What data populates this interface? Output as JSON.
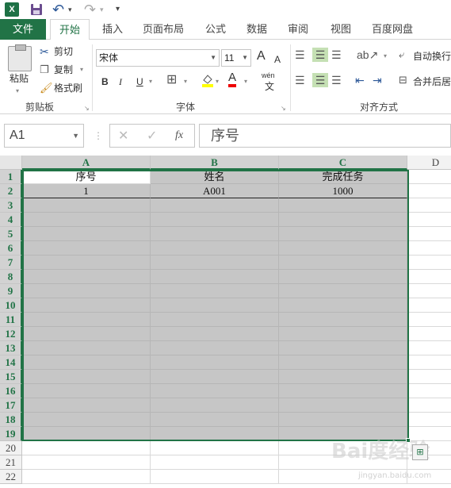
{
  "quick_access": {
    "app_icon": "X",
    "save_icon": "floppy-disk",
    "undo_icon": "↶",
    "redo_icon": "↷",
    "more_icon": "▾"
  },
  "tabs": [
    {
      "label": "文件"
    },
    {
      "label": "开始"
    },
    {
      "label": "插入"
    },
    {
      "label": "页面布局"
    },
    {
      "label": "公式"
    },
    {
      "label": "数据"
    },
    {
      "label": "审阅"
    },
    {
      "label": "视图"
    },
    {
      "label": "百度网盘"
    }
  ],
  "ribbon": {
    "clipboard": {
      "paste_label": "粘贴",
      "cut_label": "剪切",
      "copy_label": "复制",
      "format_painter_label": "格式刷",
      "group_label": "剪贴板"
    },
    "font": {
      "font_name": "宋体",
      "font_size": "11",
      "bold": "B",
      "italic": "I",
      "underline": "U",
      "wen": "wén",
      "font_color_letter": "A",
      "grow": "A",
      "shrink": "A",
      "group_label": "字体"
    },
    "alignment": {
      "wrap_text_label": "自动换行",
      "merge_label": "合并后居",
      "group_label": "对齐方式"
    }
  },
  "formula_bar": {
    "name_box": "A1",
    "cancel_icon": "✕",
    "enter_icon": "✓",
    "fx_label": "fx",
    "content": "序号"
  },
  "sheet": {
    "columns": [
      "A",
      "B",
      "C",
      "D"
    ],
    "rows": [
      "1",
      "2",
      "3",
      "4",
      "5",
      "6",
      "7",
      "8",
      "9",
      "10",
      "11",
      "12",
      "13",
      "14",
      "15",
      "16",
      "17",
      "18",
      "19",
      "20",
      "21",
      "22"
    ],
    "header_row": [
      "序号",
      "姓名",
      "完成任务"
    ],
    "data_row": [
      "1",
      "A001",
      "1000"
    ]
  },
  "watermark": {
    "brand": "Bai度经验",
    "url": "jingyan.baidu.com"
  },
  "colors": {
    "accent": "#217346",
    "selection_fill": "#c6c6c6"
  }
}
